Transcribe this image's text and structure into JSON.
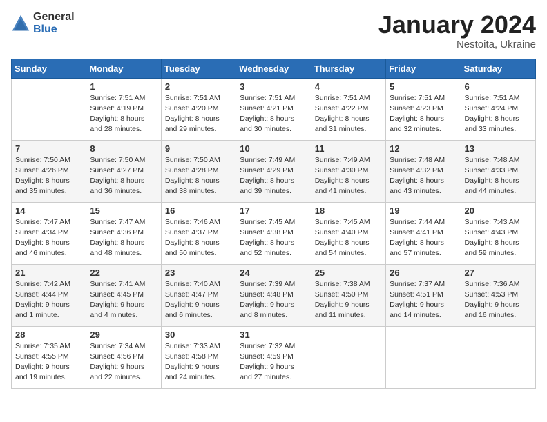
{
  "header": {
    "logo_general": "General",
    "logo_blue": "Blue",
    "title": "January 2024",
    "subtitle": "Nestoita, Ukraine"
  },
  "weekdays": [
    "Sunday",
    "Monday",
    "Tuesday",
    "Wednesday",
    "Thursday",
    "Friday",
    "Saturday"
  ],
  "weeks": [
    [
      {
        "day": "",
        "sunrise": "",
        "sunset": "",
        "daylight": ""
      },
      {
        "day": "1",
        "sunrise": "Sunrise: 7:51 AM",
        "sunset": "Sunset: 4:19 PM",
        "daylight": "Daylight: 8 hours and 28 minutes."
      },
      {
        "day": "2",
        "sunrise": "Sunrise: 7:51 AM",
        "sunset": "Sunset: 4:20 PM",
        "daylight": "Daylight: 8 hours and 29 minutes."
      },
      {
        "day": "3",
        "sunrise": "Sunrise: 7:51 AM",
        "sunset": "Sunset: 4:21 PM",
        "daylight": "Daylight: 8 hours and 30 minutes."
      },
      {
        "day": "4",
        "sunrise": "Sunrise: 7:51 AM",
        "sunset": "Sunset: 4:22 PM",
        "daylight": "Daylight: 8 hours and 31 minutes."
      },
      {
        "day": "5",
        "sunrise": "Sunrise: 7:51 AM",
        "sunset": "Sunset: 4:23 PM",
        "daylight": "Daylight: 8 hours and 32 minutes."
      },
      {
        "day": "6",
        "sunrise": "Sunrise: 7:51 AM",
        "sunset": "Sunset: 4:24 PM",
        "daylight": "Daylight: 8 hours and 33 minutes."
      }
    ],
    [
      {
        "day": "7",
        "sunrise": "Sunrise: 7:50 AM",
        "sunset": "Sunset: 4:26 PM",
        "daylight": "Daylight: 8 hours and 35 minutes."
      },
      {
        "day": "8",
        "sunrise": "Sunrise: 7:50 AM",
        "sunset": "Sunset: 4:27 PM",
        "daylight": "Daylight: 8 hours and 36 minutes."
      },
      {
        "day": "9",
        "sunrise": "Sunrise: 7:50 AM",
        "sunset": "Sunset: 4:28 PM",
        "daylight": "Daylight: 8 hours and 38 minutes."
      },
      {
        "day": "10",
        "sunrise": "Sunrise: 7:49 AM",
        "sunset": "Sunset: 4:29 PM",
        "daylight": "Daylight: 8 hours and 39 minutes."
      },
      {
        "day": "11",
        "sunrise": "Sunrise: 7:49 AM",
        "sunset": "Sunset: 4:30 PM",
        "daylight": "Daylight: 8 hours and 41 minutes."
      },
      {
        "day": "12",
        "sunrise": "Sunrise: 7:48 AM",
        "sunset": "Sunset: 4:32 PM",
        "daylight": "Daylight: 8 hours and 43 minutes."
      },
      {
        "day": "13",
        "sunrise": "Sunrise: 7:48 AM",
        "sunset": "Sunset: 4:33 PM",
        "daylight": "Daylight: 8 hours and 44 minutes."
      }
    ],
    [
      {
        "day": "14",
        "sunrise": "Sunrise: 7:47 AM",
        "sunset": "Sunset: 4:34 PM",
        "daylight": "Daylight: 8 hours and 46 minutes."
      },
      {
        "day": "15",
        "sunrise": "Sunrise: 7:47 AM",
        "sunset": "Sunset: 4:36 PM",
        "daylight": "Daylight: 8 hours and 48 minutes."
      },
      {
        "day": "16",
        "sunrise": "Sunrise: 7:46 AM",
        "sunset": "Sunset: 4:37 PM",
        "daylight": "Daylight: 8 hours and 50 minutes."
      },
      {
        "day": "17",
        "sunrise": "Sunrise: 7:45 AM",
        "sunset": "Sunset: 4:38 PM",
        "daylight": "Daylight: 8 hours and 52 minutes."
      },
      {
        "day": "18",
        "sunrise": "Sunrise: 7:45 AM",
        "sunset": "Sunset: 4:40 PM",
        "daylight": "Daylight: 8 hours and 54 minutes."
      },
      {
        "day": "19",
        "sunrise": "Sunrise: 7:44 AM",
        "sunset": "Sunset: 4:41 PM",
        "daylight": "Daylight: 8 hours and 57 minutes."
      },
      {
        "day": "20",
        "sunrise": "Sunrise: 7:43 AM",
        "sunset": "Sunset: 4:43 PM",
        "daylight": "Daylight: 8 hours and 59 minutes."
      }
    ],
    [
      {
        "day": "21",
        "sunrise": "Sunrise: 7:42 AM",
        "sunset": "Sunset: 4:44 PM",
        "daylight": "Daylight: 9 hours and 1 minute."
      },
      {
        "day": "22",
        "sunrise": "Sunrise: 7:41 AM",
        "sunset": "Sunset: 4:45 PM",
        "daylight": "Daylight: 9 hours and 4 minutes."
      },
      {
        "day": "23",
        "sunrise": "Sunrise: 7:40 AM",
        "sunset": "Sunset: 4:47 PM",
        "daylight": "Daylight: 9 hours and 6 minutes."
      },
      {
        "day": "24",
        "sunrise": "Sunrise: 7:39 AM",
        "sunset": "Sunset: 4:48 PM",
        "daylight": "Daylight: 9 hours and 8 minutes."
      },
      {
        "day": "25",
        "sunrise": "Sunrise: 7:38 AM",
        "sunset": "Sunset: 4:50 PM",
        "daylight": "Daylight: 9 hours and 11 minutes."
      },
      {
        "day": "26",
        "sunrise": "Sunrise: 7:37 AM",
        "sunset": "Sunset: 4:51 PM",
        "daylight": "Daylight: 9 hours and 14 minutes."
      },
      {
        "day": "27",
        "sunrise": "Sunrise: 7:36 AM",
        "sunset": "Sunset: 4:53 PM",
        "daylight": "Daylight: 9 hours and 16 minutes."
      }
    ],
    [
      {
        "day": "28",
        "sunrise": "Sunrise: 7:35 AM",
        "sunset": "Sunset: 4:55 PM",
        "daylight": "Daylight: 9 hours and 19 minutes."
      },
      {
        "day": "29",
        "sunrise": "Sunrise: 7:34 AM",
        "sunset": "Sunset: 4:56 PM",
        "daylight": "Daylight: 9 hours and 22 minutes."
      },
      {
        "day": "30",
        "sunrise": "Sunrise: 7:33 AM",
        "sunset": "Sunset: 4:58 PM",
        "daylight": "Daylight: 9 hours and 24 minutes."
      },
      {
        "day": "31",
        "sunrise": "Sunrise: 7:32 AM",
        "sunset": "Sunset: 4:59 PM",
        "daylight": "Daylight: 9 hours and 27 minutes."
      },
      {
        "day": "",
        "sunrise": "",
        "sunset": "",
        "daylight": ""
      },
      {
        "day": "",
        "sunrise": "",
        "sunset": "",
        "daylight": ""
      },
      {
        "day": "",
        "sunrise": "",
        "sunset": "",
        "daylight": ""
      }
    ]
  ]
}
